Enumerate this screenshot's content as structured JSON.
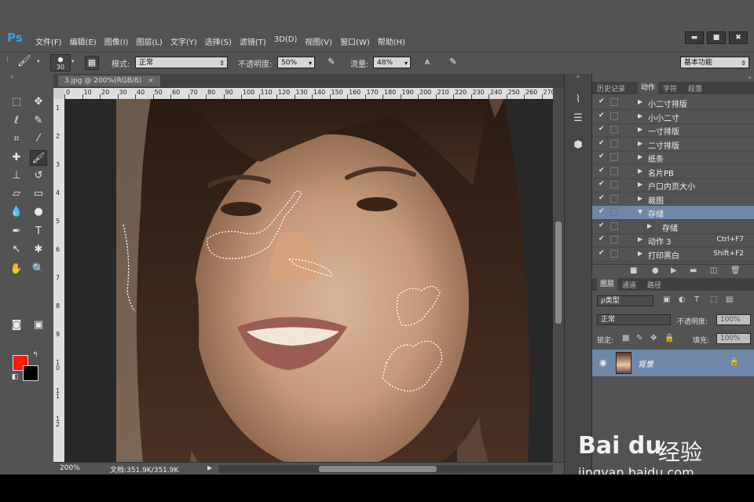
{
  "app": {
    "logo": "Ps"
  },
  "menu": [
    "文件(F)",
    "编辑(E)",
    "图像(I)",
    "图层(L)",
    "文字(Y)",
    "选择(S)",
    "滤镜(T)",
    "3D(D)",
    "视图(V)",
    "窗口(W)",
    "帮助(H)"
  ],
  "window_controls": {
    "minimize": "▬",
    "restore": "■",
    "close": "✖"
  },
  "options": {
    "brush_size": "30",
    "mode_label": "模式:",
    "mode_value": "正常",
    "opacity_label": "不透明度:",
    "opacity_value": "50%",
    "flow_label": "流量:",
    "flow_value": "48%",
    "workspace": "基本功能"
  },
  "document": {
    "tab_title": "3.jpg @ 200%(RGB/8)",
    "tab_close": "×",
    "zoom": "200%",
    "doc_info": "文档:351.9K/351.9K",
    "ruler_h": [
      "0",
      "10",
      "20",
      "30",
      "40",
      "50",
      "60",
      "70",
      "80",
      "90",
      "100",
      "110",
      "120",
      "130",
      "140",
      "150",
      "160",
      "170",
      "180",
      "190",
      "200",
      "210",
      "220",
      "230",
      "240",
      "250",
      "260",
      "270"
    ],
    "ruler_v": [
      "1",
      "2",
      "3",
      "4",
      "5",
      "6",
      "7",
      "8",
      "9",
      "1 0",
      "1 1",
      "1 2"
    ]
  },
  "actions_panel": {
    "tabs": [
      "历史记录",
      "动作",
      "字符",
      "段落"
    ],
    "active_tab": "动作",
    "rows": [
      {
        "label": "小二寸排版",
        "shortcut": "",
        "expanded": false,
        "indent": 0
      },
      {
        "label": "小小二寸",
        "shortcut": "",
        "expanded": false,
        "indent": 0
      },
      {
        "label": "一寸排版",
        "shortcut": "",
        "expanded": false,
        "indent": 0
      },
      {
        "label": "二寸排版",
        "shortcut": "",
        "expanded": false,
        "indent": 0
      },
      {
        "label": "纸条",
        "shortcut": "",
        "expanded": false,
        "indent": 0
      },
      {
        "label": "名片PB",
        "shortcut": "",
        "expanded": false,
        "indent": 0
      },
      {
        "label": "户口内页大小",
        "shortcut": "",
        "expanded": false,
        "indent": 0
      },
      {
        "label": "裁图",
        "shortcut": "",
        "expanded": false,
        "indent": 0
      },
      {
        "label": "存储",
        "shortcut": "",
        "expanded": true,
        "indent": 0,
        "selected": true
      },
      {
        "label": "存储",
        "shortcut": "",
        "expanded": false,
        "indent": 1
      },
      {
        "label": "动作 3",
        "shortcut": "Ctrl+F7",
        "expanded": false,
        "indent": 0
      },
      {
        "label": "打印黑白",
        "shortcut": "Shift+F2",
        "expanded": false,
        "indent": 0
      }
    ]
  },
  "layers_panel": {
    "tabs": [
      "图层",
      "通道",
      "路径"
    ],
    "active_tab": "图层",
    "filter_label": "ρ类型",
    "blend_mode": "正常",
    "opacity_label": "不透明度:",
    "opacity_value": "100%",
    "lock_label": "锁定:",
    "fill_label": "填充:",
    "fill_value": "100%",
    "layer_name": "背景"
  },
  "watermark": {
    "brand": "Bai du",
    "product": "经验",
    "url": "jingyan.baidu.com"
  },
  "colors": {
    "foreground": "#ff1a00",
    "background": "#000000",
    "selection": "#6f87a8"
  }
}
